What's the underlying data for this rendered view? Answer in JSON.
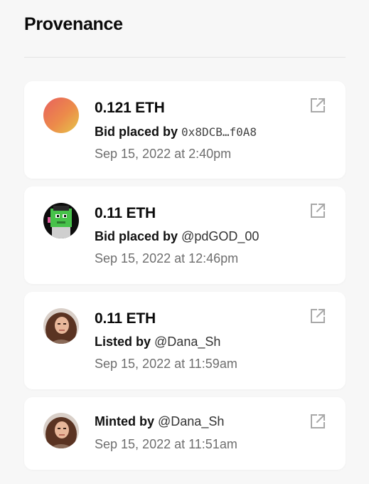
{
  "header": {
    "title": "Provenance"
  },
  "events": [
    {
      "price": "0.121 ETH",
      "verb": "Bid placed by",
      "actor": "0x8DCB…f0A8",
      "date": "Sep 15, 2022 at 2:40pm",
      "avatar_icon": "gradient-avatar-icon"
    },
    {
      "price": "0.11 ETH",
      "verb": "Bid placed by",
      "actor": "@pdGOD_00",
      "date": "Sep 15, 2022 at 12:46pm",
      "avatar_icon": "pixel-art-avatar-icon"
    },
    {
      "price": "0.11 ETH",
      "verb": "Listed by",
      "actor": "@Dana_Sh",
      "date": "Sep 15, 2022 at 11:59am",
      "avatar_icon": "profile-photo-avatar-icon"
    },
    {
      "verb": "Minted by",
      "actor": "@Dana_Sh",
      "date": "Sep 15, 2022 at 11:51am",
      "avatar_icon": "profile-photo-avatar-icon"
    }
  ],
  "colors": {
    "background": "#f7f7f7",
    "card": "#ffffff",
    "text_primary": "#0a0a0a",
    "text_secondary": "#6e6e6e",
    "icon": "#a8a8a8"
  }
}
